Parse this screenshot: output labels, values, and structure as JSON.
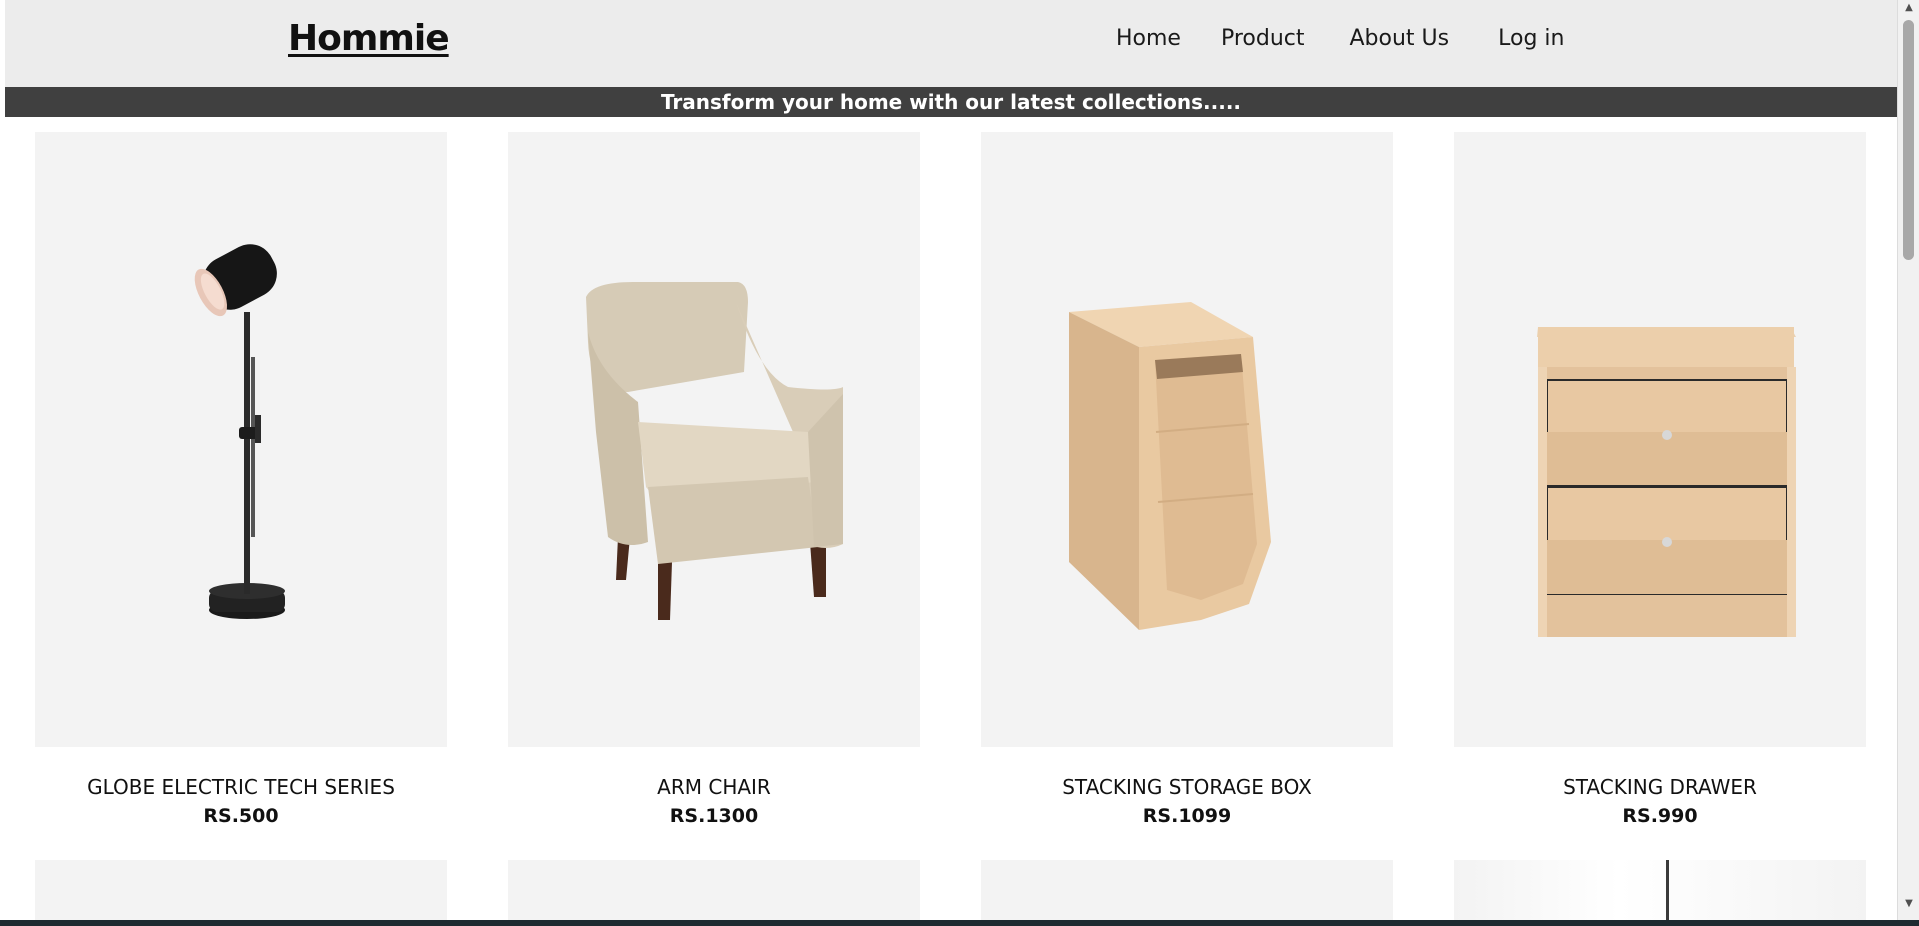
{
  "brand": {
    "name": "Hommie"
  },
  "nav": {
    "items": [
      {
        "label": "Home"
      },
      {
        "label": "Product"
      },
      {
        "label": "About Us"
      },
      {
        "label": "Log in"
      }
    ]
  },
  "banner": {
    "text": "Transform your home with our latest collections....."
  },
  "products": [
    {
      "name": "GLOBE ELECTRIC TECH SERIES",
      "price": "RS.500",
      "image": "desk-lamp-icon"
    },
    {
      "name": "ARM CHAIR",
      "price": "RS.1300",
      "image": "armchair-icon"
    },
    {
      "name": "STACKING STORAGE BOX",
      "price": "RS.1099",
      "image": "storage-box-icon"
    },
    {
      "name": "STACKING DRAWER",
      "price": "RS.990",
      "image": "drawer-icon"
    }
  ],
  "colors": {
    "header_bg": "#ececec",
    "banner_bg": "#404040",
    "card_bg": "#f3f3f3",
    "wood": "#e6c9a4"
  }
}
